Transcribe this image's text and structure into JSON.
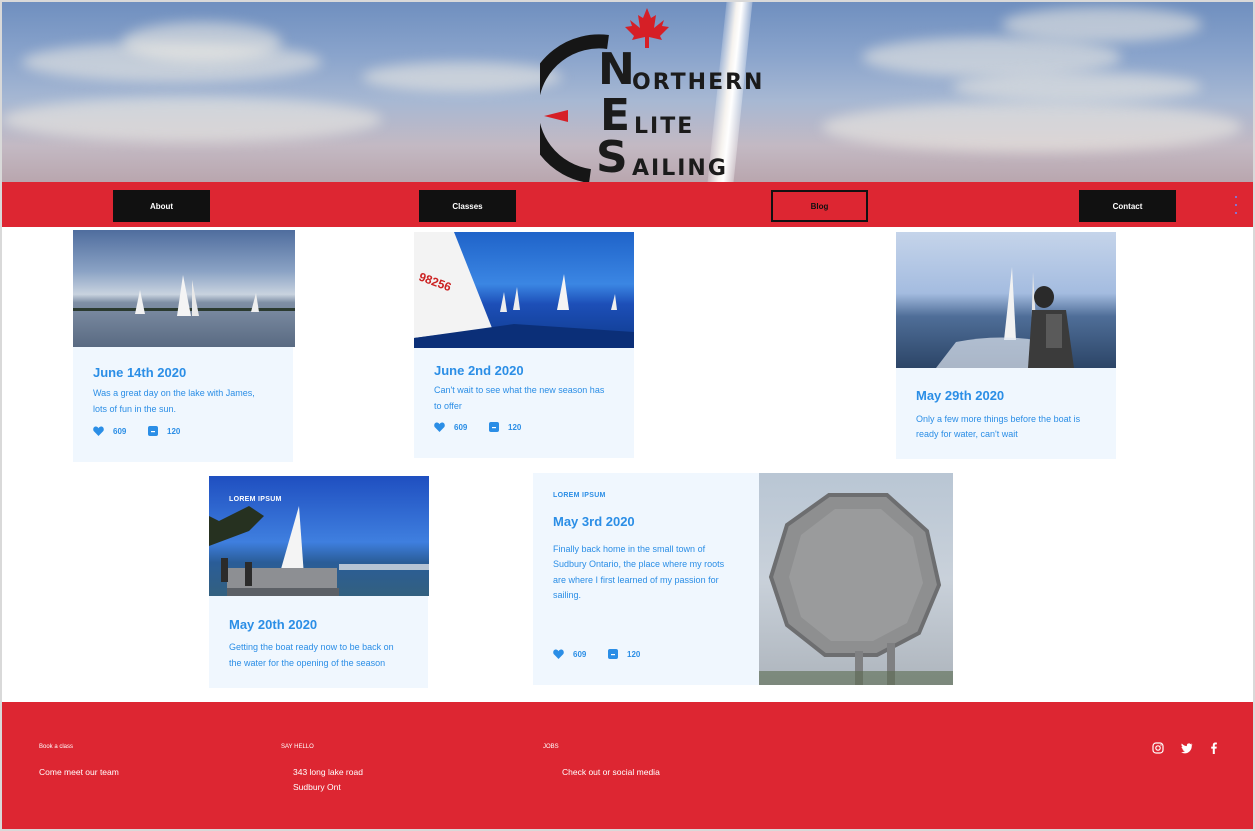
{
  "brand": {
    "logo_line1_initial": "N",
    "logo_line1_rest": "ORTHERN",
    "logo_line2_initial": "E",
    "logo_line2_rest": "LITE",
    "logo_line3_initial": "S",
    "logo_line3_rest": "AILING"
  },
  "nav": {
    "items": [
      {
        "label": "About"
      },
      {
        "label": "Classes"
      },
      {
        "label": "Blog"
      },
      {
        "label": "Contact"
      }
    ],
    "active": "Blog"
  },
  "posts": [
    {
      "title": "June 14th 2020",
      "text_line1": "Was a great day on the lake with James,",
      "text_line2": "lots of fun in the sun.",
      "likes": "609",
      "comments": "120"
    },
    {
      "title": "June 2nd 2020",
      "text_line1": "Can't wait to see what the new season has",
      "text_line2": "to offer",
      "likes": "609",
      "comments": "120"
    },
    {
      "title": "May 29th 2020",
      "text_line1": "Only a few more things before the boat is",
      "text_line2": "ready for water, can't wait"
    },
    {
      "eyebrow": "LOREM IPSUM",
      "title": "May 20th 2020",
      "text_line1": "Getting the boat ready now to be back on",
      "text_line2": "the water for the opening of the season"
    },
    {
      "eyebrow": "LOREM IPSUM",
      "title": "May 3rd 2020",
      "text_line1": "Finally back home in the small town of",
      "text_line2": "Sudbury Ontario, the place where my roots",
      "text_line3": "are where I first learned of my passion for",
      "text_line4": "sailing.",
      "likes": "609",
      "comments": "120"
    }
  ],
  "footer": {
    "col1": {
      "heading": "Book a class",
      "text": "Come meet our team"
    },
    "col2": {
      "heading": "SAY HELLO",
      "line1": "343 long lake road",
      "line2": "Sudbury Ont"
    },
    "col3": {
      "heading": "JOBS",
      "text": "Check out or social media"
    },
    "social": [
      "instagram-icon",
      "twitter-icon",
      "facebook-icon"
    ]
  },
  "colors": {
    "brand_red": "#dd2632",
    "nav_button": "#111111",
    "text_blue": "#2b8ee6",
    "card_bg": "#f0f7fe"
  }
}
